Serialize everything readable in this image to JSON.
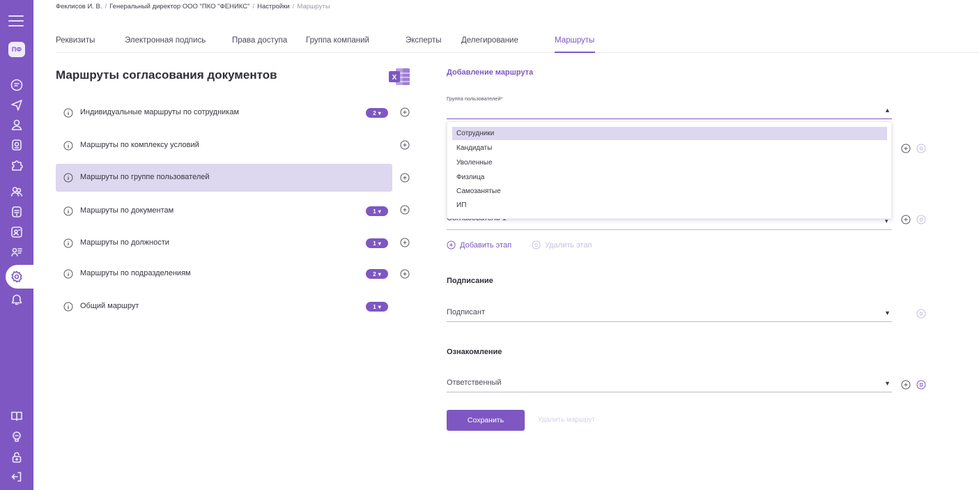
{
  "colors": {
    "accent": "#7e57c2",
    "selected_row": "#ddd7ef",
    "muted": "#c7bfdf"
  },
  "sidebar": {
    "logo": "ПФ",
    "icons": [
      "menu-icon",
      "document-icon",
      "send-icon",
      "user-icon",
      "badge-icon",
      "puzzle-icon",
      "users-icon",
      "calendar-icon",
      "id-card-icon",
      "user-list-icon",
      "settings-icon",
      "bell-icon",
      "book-icon",
      "support-icon",
      "lock-icon",
      "logout-icon"
    ]
  },
  "breadcrumb": {
    "user": "Феклисов И. В.",
    "position": "Генеральный директор ООО \"ПКО \"ФЕНИКС\"",
    "settings": "Настройки",
    "current": "Маршруты"
  },
  "tabs": [
    {
      "label": "Реквизиты"
    },
    {
      "label": "Электронная подпись"
    },
    {
      "label": "Права доступа"
    },
    {
      "label": "Группа компаний"
    },
    {
      "label": "Эксперты"
    },
    {
      "label": "Делегирование"
    },
    {
      "label": "Маршруты",
      "active": true
    }
  ],
  "left": {
    "title": "Маршруты согласования документов",
    "routes": [
      {
        "label": "Индивидуальные маршруты по сотрудникам",
        "badge": "2"
      },
      {
        "label": "Маршруты по комплексу условий",
        "badge": ""
      },
      {
        "label": "Маршруты по группе пользователей",
        "badge": "",
        "selected": true
      },
      {
        "label": "Маршруты по документам",
        "badge": "1"
      },
      {
        "label": "Маршруты по должности",
        "badge": "1"
      },
      {
        "label": "Маршруты по подразделениям",
        "badge": "2"
      },
      {
        "label": "Общий маршрут",
        "badge": "1"
      }
    ]
  },
  "right": {
    "add_title": "Добавление маршрута",
    "group_label": "Группа пользователей",
    "required_mark": "*",
    "group_value": "",
    "dropdown_options": [
      "Сотрудники",
      "Кандидаты",
      "Уволенные",
      "Физлица",
      "Самозанятые",
      "ИП"
    ],
    "approver_partial": "Согласователь 1",
    "add_stage": "Добавить этап",
    "delete_stage": "Удалить этап",
    "signing_title": "Подписание",
    "signer_placeholder": "Подписант",
    "familiarization_title": "Ознакомление",
    "responsible_placeholder": "Ответственный",
    "save_button": "Сохранить",
    "delete_route": "Удалить маршрут"
  }
}
